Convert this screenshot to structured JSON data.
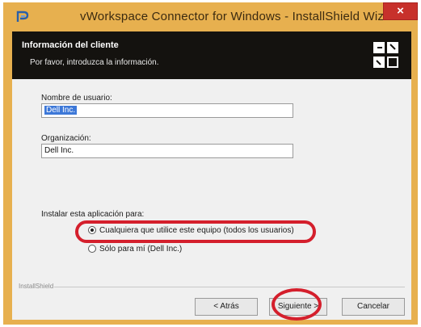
{
  "window": {
    "title": "vWorkspace Connector for Windows - InstallShield Wizard",
    "close_label": "×"
  },
  "header": {
    "title": "Información del cliente",
    "subtitle": "Por favor, introduzca la información."
  },
  "form": {
    "username_label": "Nombre de usuario:",
    "username_value": "Dell Inc.",
    "organization_label": "Organización:",
    "organization_value": "Dell Inc."
  },
  "install_for": {
    "label": "Instalar esta aplicación para:",
    "options": [
      {
        "label": "Cualquiera que utilice este equipo (todos los usuarios)",
        "selected": true
      },
      {
        "label": "Sólo para mí (Dell Inc.)",
        "selected": false
      }
    ]
  },
  "footer": {
    "brand": "InstallShield",
    "back_label": "< Atrás",
    "next_label": "Siguiente >",
    "cancel_label": "Cancelar"
  },
  "colors": {
    "frame": "#e7b04f",
    "header_bg": "#14120f",
    "highlight": "#d41f2c",
    "close_button": "#c7312b"
  }
}
